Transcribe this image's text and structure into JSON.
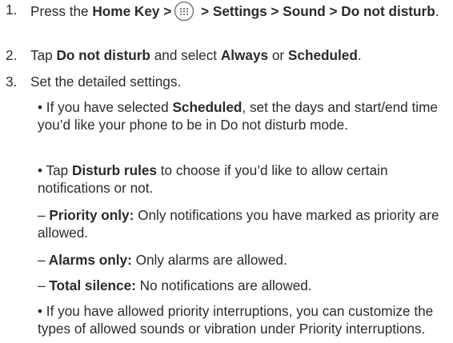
{
  "steps": [
    {
      "number": "1.",
      "parts": {
        "a": "Press the ",
        "b_home": "Home Key >",
        "b_rest": " > Settings > Sound > Do not disturb",
        "end": "."
      },
      "icon": "apps-drawer-icon"
    },
    {
      "number": "2.",
      "parts": {
        "a": "Tap ",
        "b1": "Do not disturb",
        "c": " and select ",
        "b2": "Always",
        "d": " or ",
        "b3": "Scheduled",
        "end": "."
      }
    },
    {
      "number": "3.",
      "text": "Set the detailed settings."
    }
  ],
  "details": {
    "scheduled": {
      "bullet": "•",
      "a": " If you have selected ",
      "b": "Scheduled",
      "c": ", set the days and start/end time you’d like your phone to be in Do not disturb mode."
    },
    "rules": {
      "bullet": "•",
      "a": " Tap ",
      "b": "Disturb rules",
      "c": " to choose if you’d like to allow certain notifications or not."
    },
    "priority": {
      "dash": "–",
      "b": " Priority only:",
      "c": " Only notifications you have marked as priority are allowed."
    },
    "alarms": {
      "dash": "–",
      "b": " Alarms only:",
      "c": " Only alarms are allowed."
    },
    "silence": {
      "dash": "–",
      "b": " Total silence:",
      "c": " No notifications are allowed."
    },
    "interruptions": {
      "bullet": "•",
      "c": " If you have allowed priority interruptions, you can customize the types of allowed sounds or vibration under Priority interruptions."
    }
  }
}
